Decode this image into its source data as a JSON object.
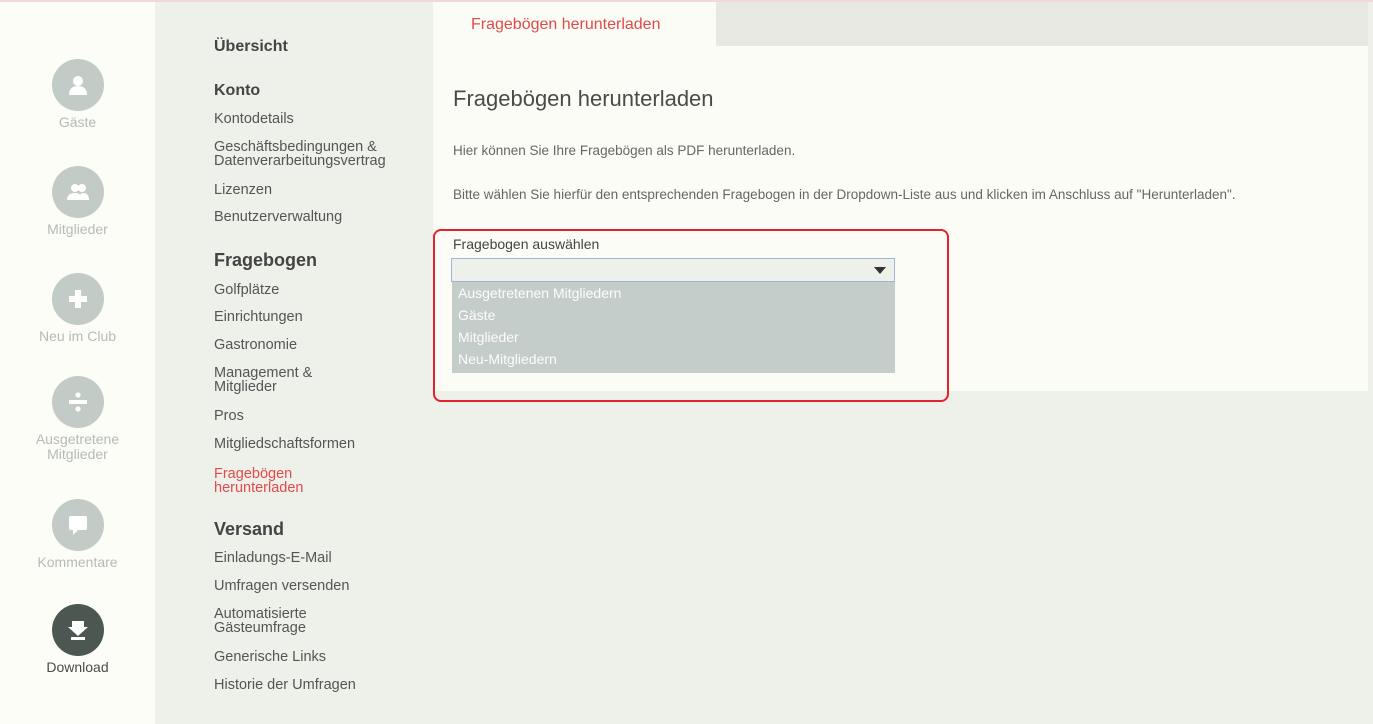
{
  "rail": {
    "items": [
      {
        "label": "Gäste",
        "icon": "user-icon",
        "active": false
      },
      {
        "label": "Mitglieder",
        "icon": "users-icon",
        "active": false
      },
      {
        "label": "Neu im Club",
        "icon": "plus-icon",
        "active": false
      },
      {
        "label": "Ausgetretene Mitglieder",
        "icon": "divide-icon",
        "active": false
      },
      {
        "label": "Kommentare",
        "icon": "comment-icon",
        "active": false
      },
      {
        "label": "Download",
        "icon": "download-icon",
        "active": true
      }
    ]
  },
  "nav": {
    "overview": "Übersicht",
    "konto": {
      "heading": "Konto",
      "items": [
        "Kontodetails",
        "Geschäftsbedingungen &",
        "Datenverarbeitungsvertrag",
        "Lizenzen",
        "Benutzerverwaltung"
      ]
    },
    "fragebogen": {
      "heading": "Fragebogen",
      "items": [
        "Golfplätze",
        "Einrichtungen",
        "Gastronomie",
        "Management &",
        "Mitglieder",
        "Pros",
        "Mitgliedschaftsformen",
        "Fragebögen",
        "herunterladen"
      ]
    },
    "versand": {
      "heading": "Versand",
      "items": [
        "Einladungs-E-Mail",
        "Umfragen versenden",
        "Automatisierte",
        "Gästeumfrage",
        "Generische Links",
        "Historie der Umfragen"
      ]
    }
  },
  "main": {
    "tab_label": "Fragebögen herunterladen",
    "title": "Fragebögen herunterladen",
    "para1": "Hier können Sie Ihre Fragebögen als PDF herunterladen.",
    "para2": "Bitte wählen Sie hierfür den entsprechenden Fragebogen in der Dropdown-Liste aus und klicken im Anschluss auf \"Herunterladen\".",
    "field_label": "Fragebogen auswählen",
    "select_value": "",
    "options": [
      "Ausgetretenen Mitgliedern",
      "Gäste",
      "Mitglieder",
      "Neu-Mitgliedern"
    ]
  },
  "colors": {
    "accent": "#e14a4a",
    "highlight_border": "#e3232b",
    "rail_icon": "#c3cbc6",
    "rail_icon_active": "#4c5751"
  }
}
